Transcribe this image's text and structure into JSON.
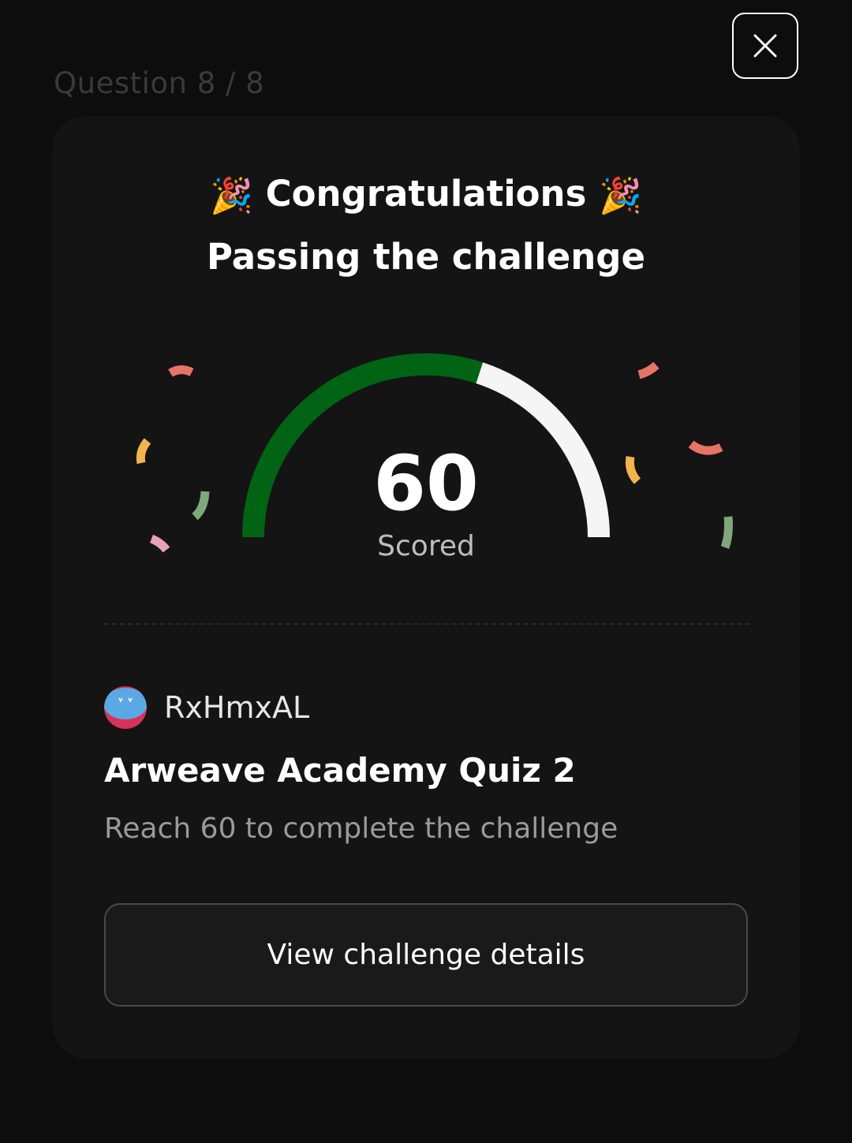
{
  "header": {
    "question_counter": "Question 8 / 8",
    "close_icon": "close-icon"
  },
  "result": {
    "title": "Congratulations",
    "party_icon": "party-popper-icon",
    "subtitle": "Passing the challenge",
    "score": "60",
    "score_label": "Scored",
    "gauge": {
      "value": 60,
      "max": 100,
      "fill_color": "#006414",
      "track_color": "#f5f5f5"
    }
  },
  "challenge": {
    "creator": "RxHmxAL",
    "avatar_icon": "avatar-icon",
    "title": "Arweave Academy Quiz 2",
    "description": "Reach 60 to complete the challenge",
    "details_button": "View challenge details"
  },
  "confetti_colors": [
    "#e87466",
    "#f2b44d",
    "#7fa87a",
    "#e8a0b8"
  ]
}
